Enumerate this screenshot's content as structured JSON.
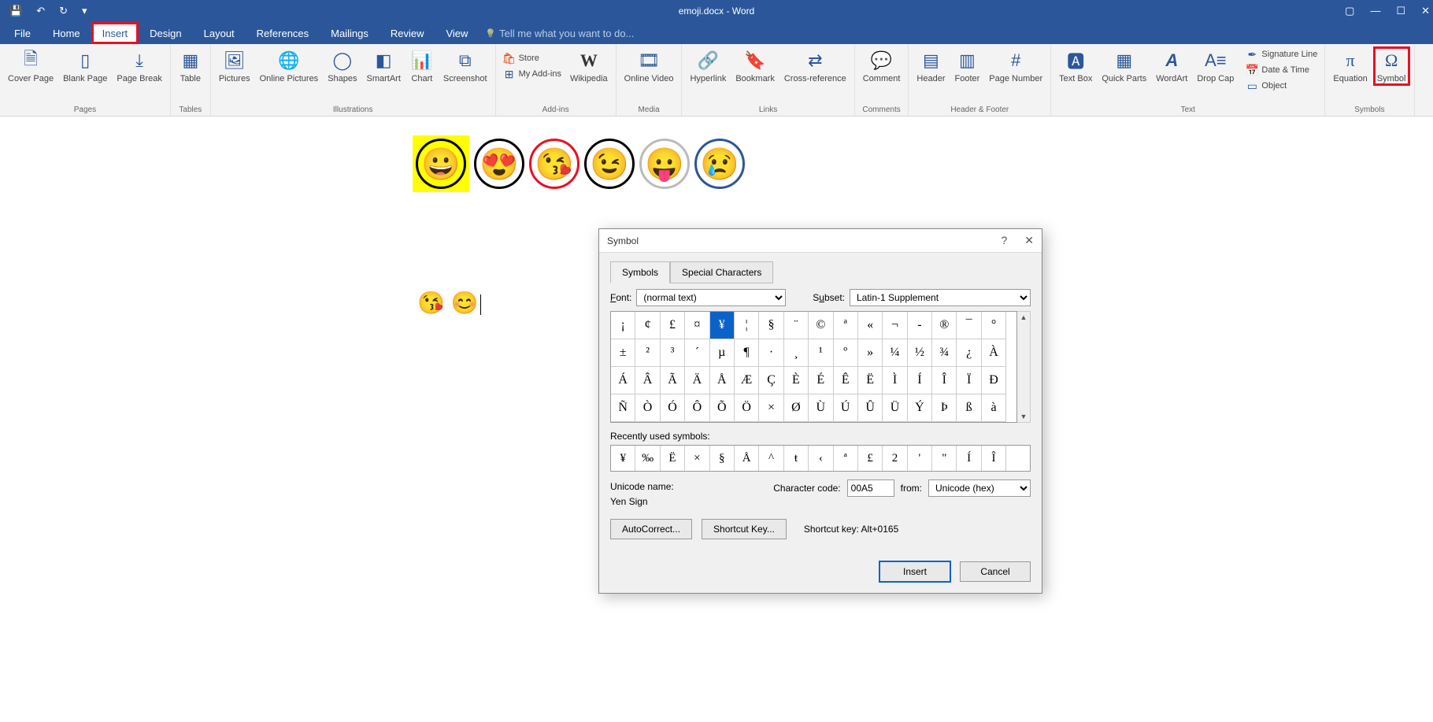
{
  "titlebar": {
    "document": "emoji.docx - Word"
  },
  "tabs": [
    "File",
    "Home",
    "Insert",
    "Design",
    "Layout",
    "References",
    "Mailings",
    "Review",
    "View"
  ],
  "tellme": "Tell me what you want to do...",
  "ribbon": {
    "pages": {
      "label": "Pages",
      "items": [
        "Cover Page",
        "Blank Page",
        "Page Break"
      ]
    },
    "tables": {
      "label": "Tables",
      "items": [
        "Table"
      ]
    },
    "illustrations": {
      "label": "Illustrations",
      "items": [
        "Pictures",
        "Online Pictures",
        "Shapes",
        "SmartArt",
        "Chart",
        "Screenshot"
      ]
    },
    "addins": {
      "label": "Add-ins",
      "store": "Store",
      "myaddins": "My Add-ins",
      "wiki": "Wikipedia"
    },
    "media": {
      "label": "Media",
      "items": [
        "Online Video"
      ]
    },
    "links": {
      "label": "Links",
      "items": [
        "Hyperlink",
        "Bookmark",
        "Cross-reference"
      ]
    },
    "comments": {
      "label": "Comments",
      "items": [
        "Comment"
      ]
    },
    "hf": {
      "label": "Header & Footer",
      "items": [
        "Header",
        "Footer",
        "Page Number"
      ]
    },
    "text": {
      "label": "Text",
      "items": [
        "Text Box",
        "Quick Parts",
        "WordArt",
        "Drop Cap"
      ],
      "sig": "Signature Line",
      "date": "Date & Time",
      "obj": "Object"
    },
    "symbols": {
      "label": "Symbols",
      "eq": "Equation",
      "sym": "Symbol"
    }
  },
  "dialog": {
    "title": "Symbol",
    "tabs": [
      "Symbols",
      "Special Characters"
    ],
    "font_label": "Font:",
    "font_value": "(normal text)",
    "subset_label": "Subset:",
    "subset_value": "Latin-1 Supplement",
    "grid": [
      [
        "¡",
        "¢",
        "£",
        "¤",
        "¥",
        "¦",
        "§",
        "¨",
        "©",
        "ª",
        "«",
        "¬",
        "-",
        "®",
        "¯",
        "°"
      ],
      [
        "±",
        "²",
        "³",
        "´",
        "µ",
        "¶",
        "·",
        "¸",
        "¹",
        "º",
        "»",
        "¼",
        "½",
        "¾",
        "¿",
        "À"
      ],
      [
        "Á",
        "Â",
        "Ã",
        "Ä",
        "Å",
        "Æ",
        "Ç",
        "È",
        "É",
        "Ê",
        "Ë",
        "Ì",
        "Í",
        "Î",
        "Ï",
        "Ð"
      ],
      [
        "Ñ",
        "Ò",
        "Ó",
        "Ô",
        "Õ",
        "Ö",
        "×",
        "Ø",
        "Ù",
        "Ú",
        "Û",
        "Ü",
        "Ý",
        "Þ",
        "ß",
        "à"
      ]
    ],
    "selected": "¥",
    "recent_label": "Recently used symbols:",
    "recent": [
      "¥",
      "‰",
      "Ë",
      "×",
      "§",
      "Å",
      "^",
      "ŧ",
      "‹",
      "ª",
      "£",
      "2",
      "'",
      "\"",
      "Í",
      "Î"
    ],
    "unicode_name_label": "Unicode name:",
    "unicode_name": "Yen Sign",
    "charcode_label": "Character code:",
    "charcode": "00A5",
    "from_label": "from:",
    "from_value": "Unicode (hex)",
    "autocorrect": "AutoCorrect...",
    "shortcutkey_btn": "Shortcut Key...",
    "shortcut_label": "Shortcut key:",
    "shortcut_value": "Alt+0165",
    "insert": "Insert",
    "cancel": "Cancel"
  }
}
